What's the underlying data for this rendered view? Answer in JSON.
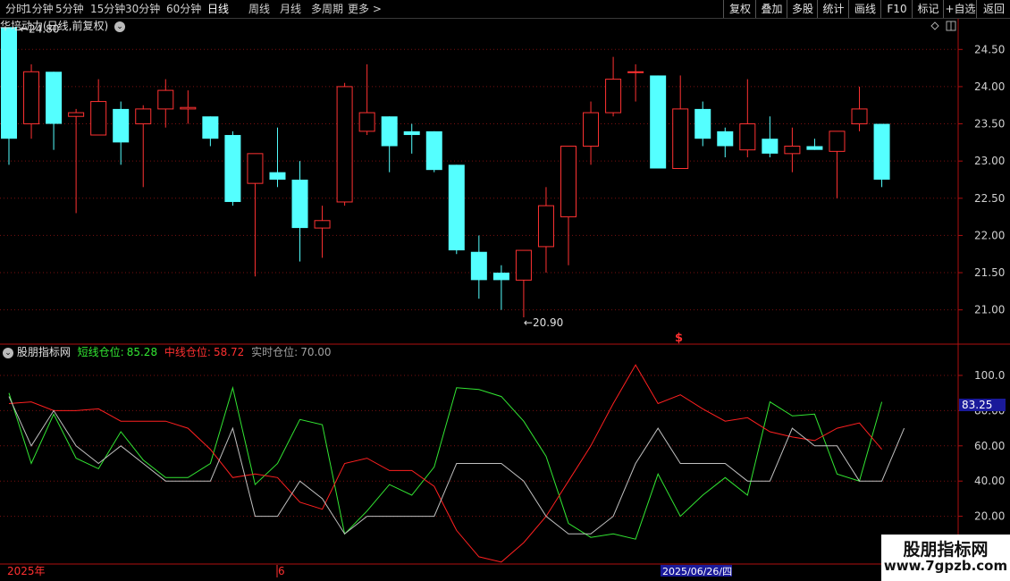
{
  "toolbar": {
    "periods": [
      "分时",
      "1分钟",
      "5分钟",
      "15分钟",
      "30分钟",
      "60分钟",
      "日线",
      "周线",
      "月线",
      "多周期",
      "更多 >"
    ],
    "active_period": "日线",
    "right_buttons": [
      "复权",
      "叠加",
      "多股",
      "统计",
      "画线",
      "F10",
      "标记",
      "+自选",
      "返回"
    ]
  },
  "stock": {
    "title": "华培动力(日线,前复权)",
    "max_label": "24.80",
    "min_label": "20.90",
    "signal_mark": "$"
  },
  "price_axis": {
    "ticks": [
      "24.50",
      "24.00",
      "23.50",
      "23.00",
      "22.50",
      "22.00",
      "21.50",
      "21.00"
    ],
    "ylim": [
      20.75,
      24.9
    ]
  },
  "indicator": {
    "name": "股朋指标网",
    "short_label": "短线仓位:",
    "short_value": "85.28",
    "mid_label": "中线仓位:",
    "mid_value": "58.72",
    "real_label": "实时仓位:",
    "real_value": "70.00",
    "current_value": "83.25",
    "ticks": [
      "100.0",
      "80.00",
      "60.00",
      "40.00",
      "20.00"
    ],
    "ylim": [
      5,
      110
    ]
  },
  "date_bar": {
    "year": "2025年",
    "month": "6",
    "cursor_date": "2025/06/26/四"
  },
  "watermark": {
    "name": "股朋指标网",
    "url": "www.7gpzb.com"
  },
  "colors": {
    "up": "#ff3232",
    "down": "#54ffff",
    "short_line": "#32e632",
    "mid_line": "#ff2020",
    "real_line": "#c0c0c0",
    "grid": "#7a1010",
    "border": "#b01010"
  },
  "chart_data": [
    {
      "type": "candlestick",
      "title": "华培动力(日线,前复权)",
      "candles": [
        {
          "o": 24.8,
          "h": 24.8,
          "l": 22.95,
          "c": 23.3
        },
        {
          "o": 23.5,
          "h": 24.3,
          "l": 23.3,
          "c": 24.2
        },
        {
          "o": 24.2,
          "h": 24.2,
          "l": 23.15,
          "c": 23.5
        },
        {
          "o": 23.6,
          "h": 23.7,
          "l": 22.3,
          "c": 23.65
        },
        {
          "o": 23.35,
          "h": 24.1,
          "l": 23.35,
          "c": 23.8
        },
        {
          "o": 23.7,
          "h": 23.8,
          "l": 22.95,
          "c": 23.25
        },
        {
          "o": 23.5,
          "h": 23.75,
          "l": 22.65,
          "c": 23.7
        },
        {
          "o": 23.7,
          "h": 24.1,
          "l": 23.45,
          "c": 23.95
        },
        {
          "o": 23.7,
          "h": 23.95,
          "l": 23.5,
          "c": 23.72
        },
        {
          "o": 23.6,
          "h": 23.6,
          "l": 23.2,
          "c": 23.3
        },
        {
          "o": 23.35,
          "h": 23.4,
          "l": 22.4,
          "c": 22.45
        },
        {
          "o": 22.7,
          "h": 23.1,
          "l": 21.45,
          "c": 23.1
        },
        {
          "o": 22.85,
          "h": 23.45,
          "l": 22.65,
          "c": 22.75
        },
        {
          "o": 22.75,
          "h": 23.0,
          "l": 21.65,
          "c": 22.1
        },
        {
          "o": 22.1,
          "h": 22.4,
          "l": 21.7,
          "c": 22.2
        },
        {
          "o": 22.45,
          "h": 24.05,
          "l": 22.4,
          "c": 24.0
        },
        {
          "o": 23.4,
          "h": 24.3,
          "l": 23.35,
          "c": 23.65
        },
        {
          "o": 23.6,
          "h": 23.6,
          "l": 22.85,
          "c": 23.2
        },
        {
          "o": 23.4,
          "h": 23.5,
          "l": 23.1,
          "c": 23.35
        },
        {
          "o": 23.4,
          "h": 23.4,
          "l": 22.85,
          "c": 22.88
        },
        {
          "o": 22.95,
          "h": 22.95,
          "l": 21.75,
          "c": 21.8
        },
        {
          "o": 21.78,
          "h": 22.0,
          "l": 21.15,
          "c": 21.4
        },
        {
          "o": 21.5,
          "h": 21.6,
          "l": 21.0,
          "c": 21.4
        },
        {
          "o": 21.4,
          "h": 21.8,
          "l": 20.9,
          "c": 21.8
        },
        {
          "o": 21.85,
          "h": 22.65,
          "l": 21.5,
          "c": 22.4
        },
        {
          "o": 22.25,
          "h": 23.2,
          "l": 21.6,
          "c": 23.2
        },
        {
          "o": 23.2,
          "h": 23.8,
          "l": 22.95,
          "c": 23.65
        },
        {
          "o": 23.65,
          "h": 24.4,
          "l": 23.6,
          "c": 24.1
        },
        {
          "o": 24.2,
          "h": 24.3,
          "l": 23.8,
          "c": 24.2
        },
        {
          "o": 24.15,
          "h": 24.15,
          "l": 22.9,
          "c": 22.9
        },
        {
          "o": 22.9,
          "h": 24.15,
          "l": 22.9,
          "c": 23.7
        },
        {
          "o": 23.7,
          "h": 23.8,
          "l": 23.2,
          "c": 23.3
        },
        {
          "o": 23.4,
          "h": 23.45,
          "l": 23.05,
          "c": 23.2
        },
        {
          "o": 23.15,
          "h": 24.1,
          "l": 23.05,
          "c": 23.5
        },
        {
          "o": 23.3,
          "h": 23.6,
          "l": 23.05,
          "c": 23.1
        },
        {
          "o": 23.1,
          "h": 23.45,
          "l": 22.85,
          "c": 23.2
        },
        {
          "o": 23.2,
          "h": 23.3,
          "l": 23.15,
          "c": 23.15
        },
        {
          "o": 23.13,
          "h": 23.4,
          "l": 22.5,
          "c": 23.4
        },
        {
          "o": 23.5,
          "h": 24.0,
          "l": 23.4,
          "c": 23.7
        },
        {
          "o": 23.5,
          "h": 23.5,
          "l": 22.65,
          "c": 22.75
        }
      ],
      "ylim": [
        20.75,
        24.9
      ]
    },
    {
      "type": "line",
      "title": "股朋指标网",
      "series": [
        {
          "name": "短线仓位",
          "values": [
            90,
            50,
            78,
            53,
            47,
            68,
            52,
            42,
            42,
            50,
            93,
            38,
            50,
            75,
            72,
            10,
            23,
            38,
            32,
            48,
            93,
            92,
            88,
            74,
            54,
            16,
            8,
            10,
            7,
            44,
            20,
            32,
            42,
            32,
            85,
            77,
            78,
            44,
            40,
            85
          ]
        },
        {
          "name": "中线仓位",
          "values": [
            84,
            85,
            80,
            80,
            81,
            74,
            74,
            74,
            70,
            58,
            42,
            44,
            42,
            28,
            24,
            50,
            53,
            46,
            46,
            37,
            12,
            -3,
            -6,
            5,
            20,
            40,
            60,
            84,
            106,
            84,
            89,
            81,
            74,
            76,
            68,
            65,
            63,
            70,
            73,
            58
          ]
        },
        {
          "name": "实时仓位",
          "values": [
            88,
            60,
            80,
            60,
            50,
            60,
            50,
            40,
            40,
            40,
            70,
            20,
            20,
            40,
            30,
            10,
            20,
            20,
            20,
            20,
            50,
            50,
            50,
            40,
            20,
            10,
            10,
            20,
            50,
            70,
            50,
            50,
            50,
            40,
            40,
            70,
            60,
            60,
            40,
            40,
            70
          ]
        }
      ],
      "ylim": [
        5,
        110
      ]
    }
  ]
}
